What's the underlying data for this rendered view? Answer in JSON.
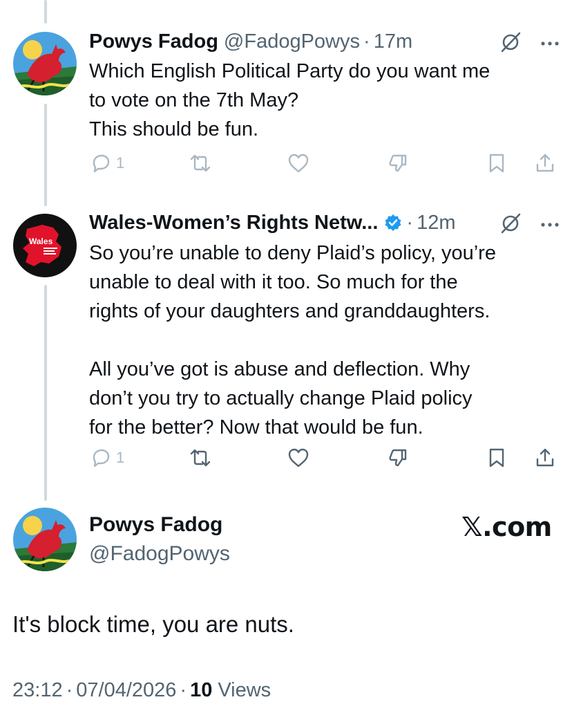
{
  "tweet1": {
    "name": "Powys Fadog",
    "handle": "@FadogPowys",
    "dot": "·",
    "time": "17m",
    "lines": [
      "Which English Political Party do you want me",
      "to vote on the 7th May?",
      "This should be fun."
    ],
    "reply_count": "1"
  },
  "tweet2": {
    "name": "Wales-Women’s Rights Netw...",
    "dot": "·",
    "time": "12m",
    "avatar_text": "Wales",
    "lines": [
      "So you’re unable to deny Plaid’s policy, you’re",
      "unable to deal with it too. So much for the",
      "rights of your daughters and granddaughters.",
      "",
      "All you’ve got is abuse and deflection. Why",
      "don’t you try to actually change Plaid policy",
      "for the better? Now that would be fun."
    ],
    "reply_count": "1"
  },
  "main": {
    "name": "Powys Fadog",
    "handle": "@FadogPowys",
    "brand": "𝕏.com",
    "text": "It's block time, you are nuts.",
    "time": "23:12",
    "dot": "·",
    "date": "07/04/2026",
    "views_count": "10",
    "views_label": "Views"
  },
  "colors": {
    "accent": "#1d9bf0",
    "muted": "#536471",
    "faded": "#aab8c2",
    "thread": "#cfd9de",
    "wales_red": "#e0132b"
  },
  "icons": [
    "reply-icon",
    "retweet-icon",
    "like-icon",
    "dislike-icon",
    "bookmark-icon",
    "share-icon",
    "grok-icon",
    "more-icon",
    "verified-badge-icon"
  ]
}
